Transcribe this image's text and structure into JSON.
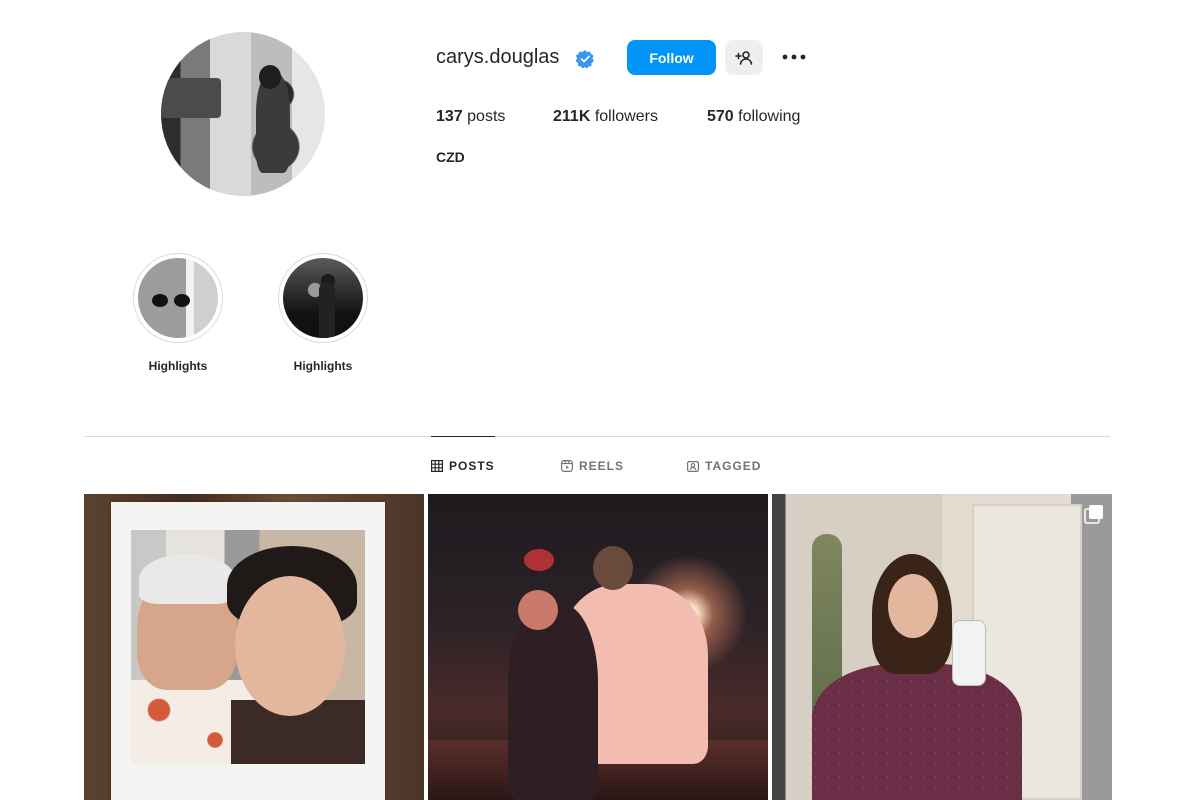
{
  "profile": {
    "username": "carys.douglas",
    "verified": true,
    "follow_label": "Follow",
    "stats": {
      "posts_count": "137",
      "posts_label": "posts",
      "followers_count": "211K",
      "followers_label": "followers",
      "following_count": "570",
      "following_label": "following"
    },
    "bio": "CZD"
  },
  "highlights": [
    {
      "label": "Highlights"
    },
    {
      "label": "Highlights"
    }
  ],
  "tabs": [
    {
      "label": "POSTS",
      "icon": "grid-icon",
      "active": true
    },
    {
      "label": "REELS",
      "icon": "reels-icon",
      "active": false
    },
    {
      "label": "TAGGED",
      "icon": "tagged-icon",
      "active": false
    }
  ],
  "colors": {
    "accent": "#0095f6",
    "text": "#262626",
    "muted": "#737373",
    "border": "#dbdbdb"
  }
}
